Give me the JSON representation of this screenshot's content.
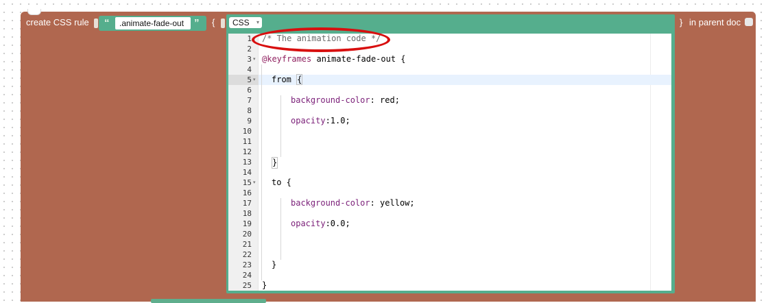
{
  "block": {
    "create_label": "create CSS rule",
    "selector_value": ".animate-fade-out",
    "open_brace": "{",
    "close_brace": "}",
    "in_parent_label": "in parent doc",
    "quote_open": "“",
    "quote_close": "”"
  },
  "css_dropdown": {
    "selected": "CSS",
    "arrow": "▾"
  },
  "editor": {
    "line_numbers": [
      "1",
      "2",
      "3",
      "4",
      "5",
      "6",
      "7",
      "8",
      "9",
      "10",
      "11",
      "12",
      "13",
      "14",
      "15",
      "16",
      "17",
      "18",
      "19",
      "20",
      "21",
      "22",
      "23",
      "24",
      "25"
    ],
    "fold_marker": "▾",
    "active_line": "5",
    "lines": {
      "l1": "/* The animation code */",
      "l3_at": "@keyframes",
      "l3_rest": " animate-fade-out {",
      "l5_kw": "from ",
      "l5_brace": "{",
      "l7_prop": "background-color",
      "l7_val": ": red;",
      "l9_prop": "opacity",
      "l9_val": ":1.0;",
      "l13": "}",
      "l15": "to {",
      "l17_prop": "background-color",
      "l17_val": ": yellow;",
      "l19_prop": "opacity",
      "l19_val": ":0.0;",
      "l23": "}",
      "l25": "}"
    }
  },
  "annotation": {
    "color": "#d80f0f",
    "shape": "hand-drawn ellipse around comment line"
  },
  "colors": {
    "block": "#b0674f",
    "css_block": "#55ae8d",
    "annotation": "#d80f0f"
  }
}
